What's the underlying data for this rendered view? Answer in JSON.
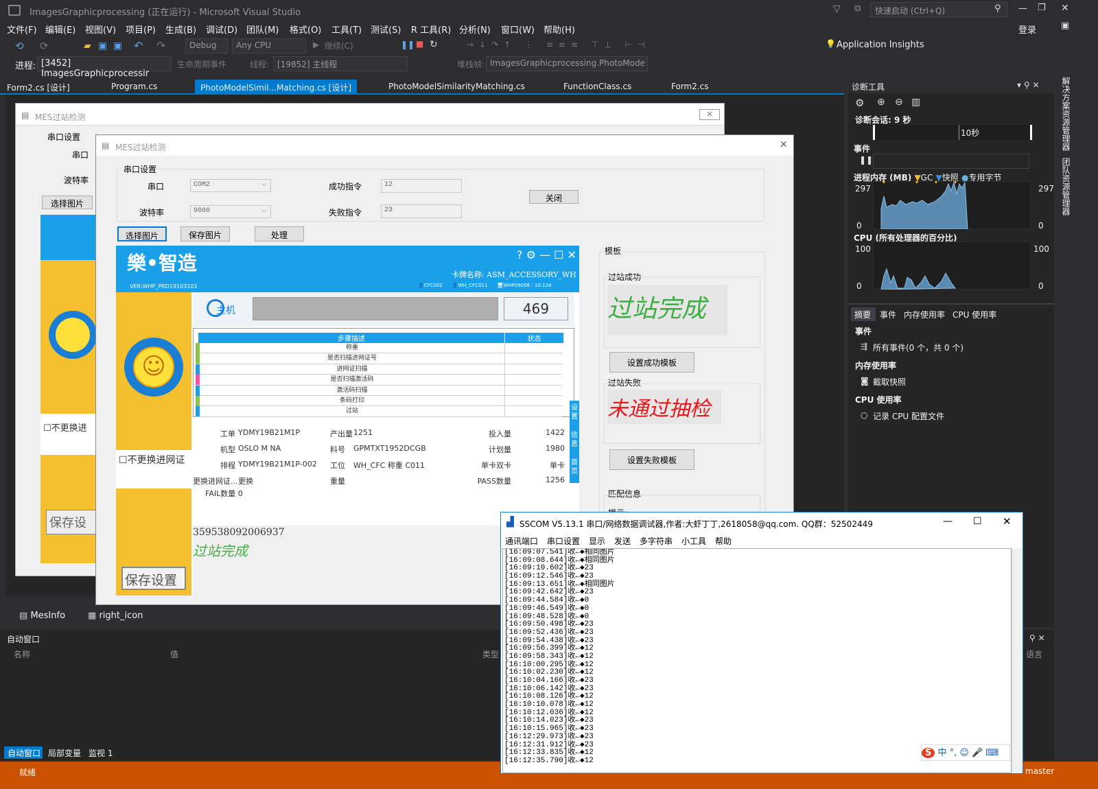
{
  "vs": {
    "title": "ImagesGraphicprocessing (正在运行) - Microsoft Visual Studio",
    "quick_launch": "快速启动 (Ctrl+Q)",
    "login": "登录",
    "menus": [
      "文件(F)",
      "编辑(E)",
      "视图(V)",
      "项目(P)",
      "生成(B)",
      "调试(D)",
      "团队(M)",
      "格式(O)",
      "工具(T)",
      "测试(S)",
      "R 工具(R)",
      "分析(N)",
      "窗口(W)",
      "帮助(H)"
    ],
    "config": "Debug",
    "platform": "Any CPU",
    "continue": "继续(C)",
    "app_insights": "Application Insights",
    "process_label": "进程:",
    "process": "[3452] ImagesGraphicprocessir",
    "lifecycle": "生命周期事件",
    "thread_label": "线程:",
    "thread": "[19852] 主线程",
    "stack_label": "堆栈帧:",
    "stack": "ImagesGraphicprocessing.PhotoMode",
    "tabs": [
      "Form2.cs [设计]",
      "Program.cs",
      "PhotoModelSimil...Matching.cs [设计]",
      "PhotoModelSimilarityMatching.cs",
      "FunctionClass.cs",
      "Form2.cs"
    ],
    "side_tabs": [
      "解决方案资源管理器",
      "团队资源管理器"
    ],
    "bottom_tabs": [
      "MesInfo",
      "right_icon"
    ],
    "autos": {
      "title": "自动窗口",
      "col_name": "名称",
      "col_value": "值",
      "col_type": "类型",
      "col_lang": "语言",
      "tabs": [
        "自动窗口",
        "局部变量",
        "监视 1"
      ]
    },
    "status": {
      "ready": "就绪",
      "branch": "master"
    }
  },
  "diag": {
    "title": "诊断工具",
    "session": "诊断会话: 9 秒",
    "time": "10秒",
    "events": "事件",
    "mem": "进程内存 (MB)",
    "gc": "GC",
    "snap": "快照",
    "private": "专用字节",
    "mem_max": "297",
    "mem_min": "0",
    "cpu": "CPU (所有处理器的百分比)",
    "cpu_max": "100",
    "cpu_min": "0",
    "tabs": [
      "摘要",
      "事件",
      "内存使用率",
      "CPU 使用率"
    ],
    "sec_events": "事件",
    "all_events": "所有事件(0 个，共 0 个)",
    "sec_mem": "内存使用率",
    "take_snap": "截取快照",
    "sec_cpu": "CPU 使用率",
    "record_cpu": "记录 CPU 配置文件"
  },
  "back_form": {
    "title": "MES过站检测",
    "serial_group": "串口设置",
    "port": "串口",
    "baud": "波特率",
    "select_img": "选择图片",
    "no_change": "不更换进",
    "save": "保存设"
  },
  "form": {
    "title": "MES过站检测",
    "serial_group": "串口设置",
    "port_label": "串口",
    "port_val": "COM2",
    "baud_label": "波特率",
    "baud_val": "9600",
    "ok_cmd_label": "成功指令",
    "ok_cmd": "12",
    "fail_cmd_label": "失败指令",
    "fail_cmd": "23",
    "close": "关闭",
    "select_img": "选择图片",
    "save_img": "保存图片",
    "process": "处理",
    "template": "模板",
    "success": "过站成功",
    "success_text": "过站完成",
    "set_success": "设置成功模板",
    "fail": "过站失败",
    "fail_text": "未通过抽检",
    "set_fail": "设置失败模板",
    "match": "匹配信息",
    "hint": "提示:",
    "result_num": "359538092006937",
    "result_text": "过站完成"
  },
  "mes": {
    "logo": "樂•智造",
    "ver": "VER:WHP_PRD19103101",
    "card_label": "卡牌名称:",
    "card": "ASM_ACCESSORY_WH",
    "u1": "CFC002",
    "u2": "WH_CFC011",
    "u3": "WHP09006 - 10.124",
    "host": "主机",
    "count": "469",
    "col_step": "步骤描述",
    "col_status": "状态",
    "steps": [
      "称重",
      "是否扫描进网证号",
      "进网证扫描",
      "是否扫描激活码",
      "激活码扫描",
      "条码打印",
      "过站"
    ],
    "side": [
      "设置",
      "信息",
      "首页"
    ],
    "info": [
      [
        "工单",
        "YDMY19B21M1P",
        "产出量",
        "1251",
        "投入量",
        "1422"
      ],
      [
        "机型",
        "OSLO M NA",
        "料号",
        "GPMTXT1952DCGB",
        "计划量",
        "1980"
      ],
      [
        "排程",
        "YDMY19B21M1P-002",
        "工位",
        "WH_CFC 称重 C011",
        "单卡双卡",
        "单卡"
      ],
      [
        "更换进网证...",
        "更换",
        "重量",
        "",
        "PASS数量",
        "1256"
      ]
    ],
    "fail_label": "FAIL数量",
    "fail_val": "0",
    "no_change": "不更换进网证",
    "save": "保存设置"
  },
  "sscom": {
    "title": "SSCOM V5.13.1 串口/网络数据调试器,作者:大虾丁丁,2618058@qq.com. QQ群：52502449",
    "menus": [
      "通讯端口",
      "串口设置",
      "显示",
      "发送",
      "多字符串",
      "小工具",
      "帮助"
    ],
    "ime": "中",
    "log": [
      "[16:09:07.541]收←◆相同图片",
      "[16:09:08.644]收←◆相同图片",
      "[16:09:10.602]收←◆23",
      "[16:09:12.546]收←◆23",
      "[16:09:13.651]收←◆相同图片",
      "[16:09:42.642]收←◆23",
      "[16:09:44.584]收←◆0",
      "[16:09:46.549]收←◆0",
      "[16:09:48.528]收←◆0",
      "[16:09:50.498]收←◆23",
      "[16:09:52.436]收←◆23",
      "[16:09:54.438]收←◆23",
      "[16:09:56.399]收←◆12",
      "[16:09:58.343]收←◆12",
      "[16:10:00.295]收←◆12",
      "[16:10:02.230]收←◆12",
      "[16:10:04.166]收←◆23",
      "[16:10:06.142]收←◆23",
      "[16:10:08.126]收←◆12",
      "[16:10:10.078]收←◆12",
      "[16:10:12.036]收←◆12",
      "[16:10:14.023]收←◆23",
      "[16:10:15.965]收←◆23",
      "[16:12:29.973]收←◆23",
      "[16:12:31.912]收←◆23",
      "[16:12:33.835]收←◆12",
      "[16:12:35.790]收←◆12"
    ]
  },
  "colors": {
    "vs_bg": "#2d2d30",
    "accent": "#007acc",
    "mes_blue": "#1aa0e8",
    "mes_yellow": "#f5c02f",
    "ok_green": "#3cb043",
    "fail_red": "#e8161a",
    "status_orange": "#ca5100"
  }
}
